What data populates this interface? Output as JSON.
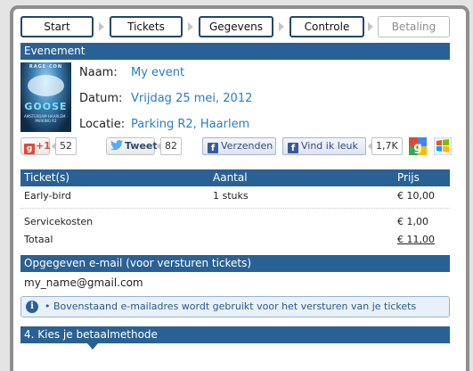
{
  "steps": [
    {
      "label": "Start"
    },
    {
      "label": "Tickets"
    },
    {
      "label": "Gegevens"
    },
    {
      "label": "Controle"
    },
    {
      "label": "Betaling"
    }
  ],
  "event": {
    "section_title": "Evenement",
    "poster_title": "RAGE·CON",
    "poster_logo": "GOOSE",
    "poster_sub": "AMSTERDAM HAARLEM · PARKING R2",
    "name_label": "Naam:",
    "name_value": "My event",
    "date_label": "Datum:",
    "date_value": "Vrijdag 25 mei, 2012",
    "location_label": "Locatie:",
    "location_value": "Parking R2, Haarlem"
  },
  "social": {
    "gplus_label": "+1",
    "gplus_count": "52",
    "tweet_label": "Tweet",
    "tweet_count": "82",
    "fb_send_label": "Verzenden",
    "fb_like_label": "Vind ik leuk",
    "fb_like_count": "1,7K"
  },
  "tickets_table": {
    "headers": {
      "ticket": "Ticket(s)",
      "amount": "Aantal",
      "price": "Prijs"
    },
    "rows": [
      {
        "ticket": "Early-bird",
        "amount": "1 stuks",
        "price": "€ 10,00"
      }
    ],
    "service_label": "Servicekosten",
    "service_price": "€ 1,00",
    "total_label": "Totaal",
    "total_price": "€ 11,00"
  },
  "email": {
    "section_title": "Opgegeven e-mail (voor versturen tickets)",
    "value": "my_name@gmail.com",
    "info_icon": "i",
    "info_text": "• Bovenstaand e-mailadres wordt gebruikt voor het versturen van je tickets"
  },
  "payment": {
    "section_title": "4. Kies je betaalmethode"
  },
  "colors": {
    "header_blue": "#2a6194",
    "link_blue": "#2a7cc6",
    "step_border": "#24466f",
    "facebook": "#3b5998"
  },
  "icons": [
    "google-plus-icon",
    "twitter-bird-icon",
    "facebook-icon",
    "google-icon",
    "windows-live-icon",
    "info-icon"
  ]
}
